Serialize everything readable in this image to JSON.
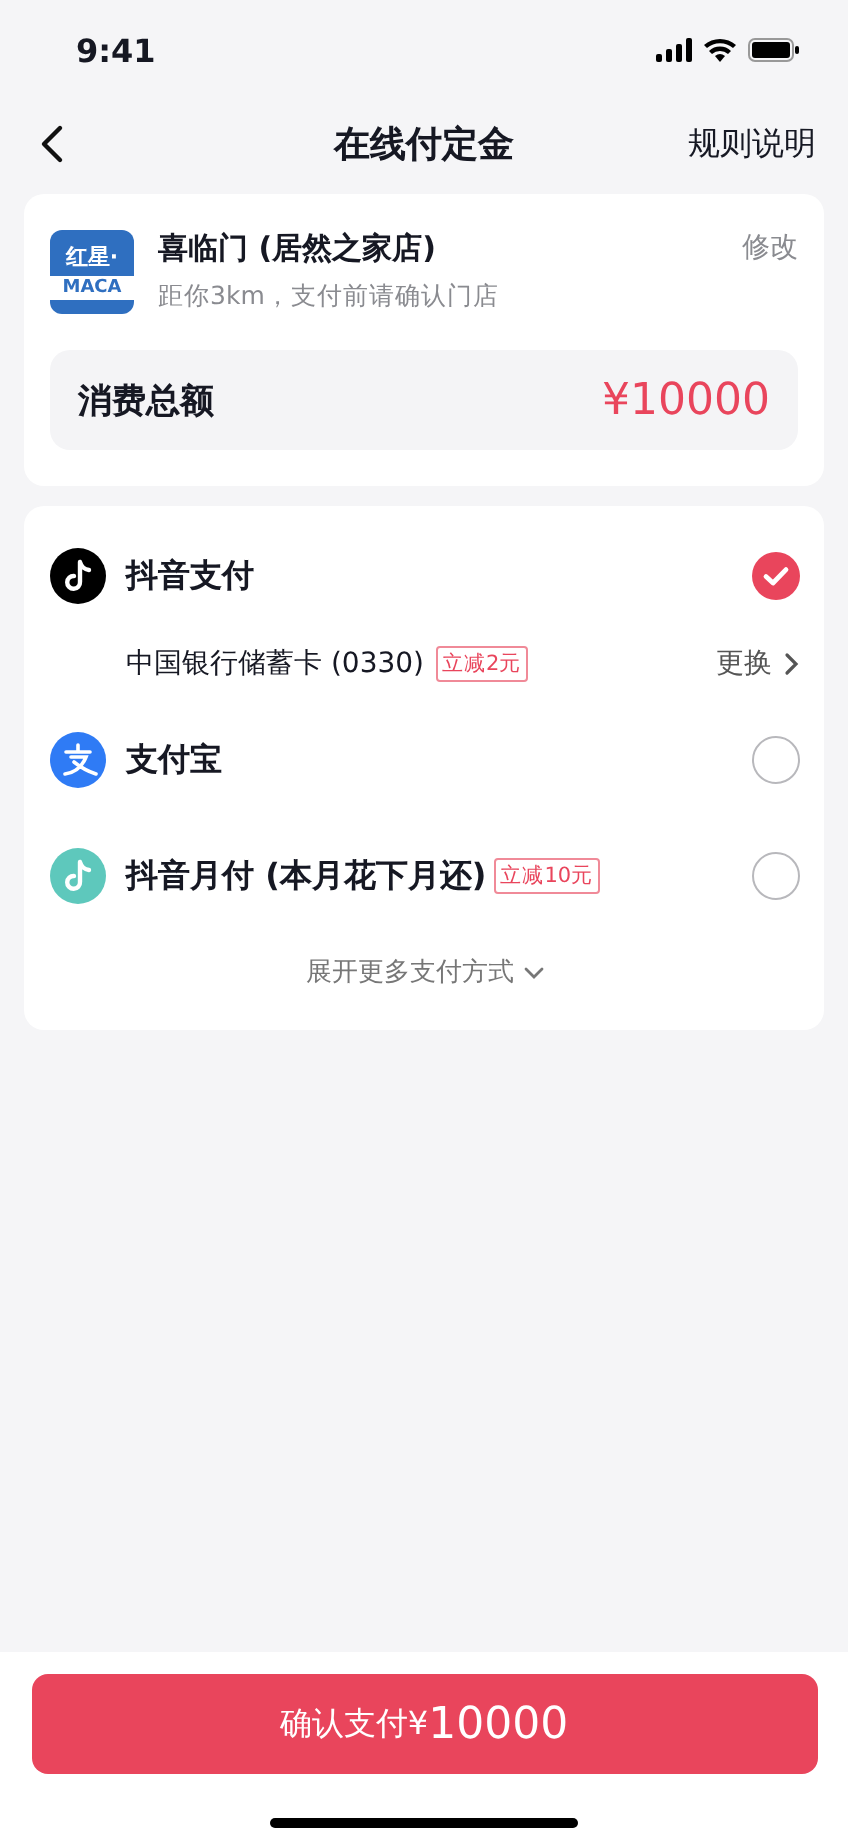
{
  "status_bar": {
    "time": "9:41"
  },
  "nav": {
    "title": "在线付定金",
    "action": "规则说明"
  },
  "store": {
    "logo_top": "红星·",
    "logo_bottom": "MACA",
    "name": "喜临门 (居然之家店)",
    "note": "距你3km，支付前请确认门店",
    "edit": "修改",
    "total_label": "消费总额",
    "total": "¥10000"
  },
  "payment_methods": [
    {
      "kind": "douyin",
      "name": "抖音支付",
      "selected": true,
      "card": "中国银行储蓄卡 (0330)",
      "card_badge": "立减2元",
      "change": "更换"
    },
    {
      "kind": "alipay",
      "name": "支付宝",
      "selected": false
    },
    {
      "kind": "monthly",
      "name": "抖音月付 (本月花下月还)",
      "badge": "立减10元",
      "selected": false
    }
  ],
  "more": "展开更多支付方式",
  "confirm": {
    "label": "确认支付¥",
    "amount": "10000"
  }
}
